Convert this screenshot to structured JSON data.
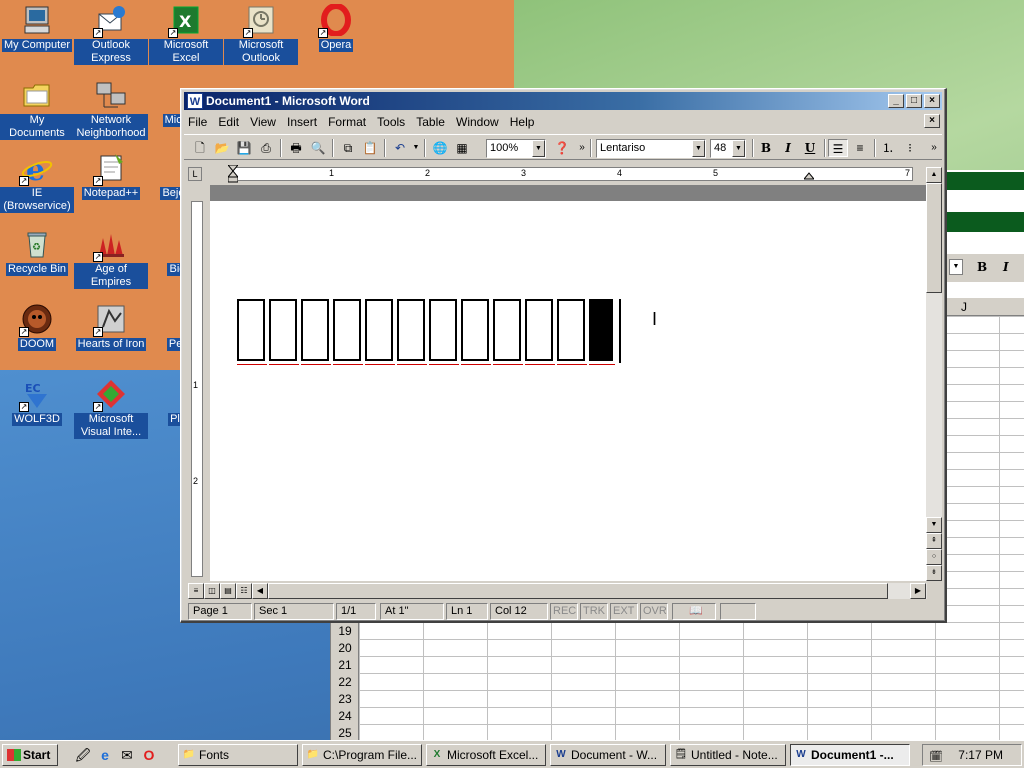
{
  "desktop": {
    "icons": [
      {
        "label": "My Computer",
        "icon": "computer-icon"
      },
      {
        "label": "Outlook Express",
        "icon": "outlook-express-icon"
      },
      {
        "label": "Microsoft Excel",
        "icon": "excel-icon"
      },
      {
        "label": "Microsoft Outlook",
        "icon": "outlook-icon"
      },
      {
        "label": "Opera",
        "icon": "opera-icon"
      },
      {
        "label": "My Documents",
        "icon": "folder-icon"
      },
      {
        "label": "Network Neighborhood",
        "icon": "network-icon"
      },
      {
        "label": "Mic Fron",
        "icon": "frontpage-icon"
      },
      {
        "label": "IE (Browservice)",
        "icon": "ie-icon"
      },
      {
        "label": "Notepad++",
        "icon": "notepad-icon"
      },
      {
        "label": "Bejew De",
        "icon": "bejeweled-icon"
      },
      {
        "label": "Recycle Bin",
        "icon": "recycle-bin-icon"
      },
      {
        "label": "Age of Empires",
        "icon": "age-of-empires-icon"
      },
      {
        "label": "Big De",
        "icon": "game-icon"
      },
      {
        "label": "DOOM",
        "icon": "doom-icon"
      },
      {
        "label": "Hearts of Iron",
        "icon": "hearts-of-iron-icon"
      },
      {
        "label": "Peggle",
        "icon": "peggle-icon"
      },
      {
        "label": "WOLF3D",
        "icon": "wolf3d-icon"
      },
      {
        "label": "Microsoft Visual Inte...",
        "icon": "visual-interdev-icon"
      },
      {
        "label": "Pla Zo",
        "icon": "game-icon"
      }
    ]
  },
  "excel": {
    "column_j": "J",
    "rows": [
      "19",
      "20",
      "21",
      "22",
      "23",
      "24",
      "25"
    ]
  },
  "word": {
    "title": "Document1 - Microsoft Word",
    "menu": [
      "File",
      "Edit",
      "View",
      "Insert",
      "Format",
      "Tools",
      "Table",
      "Window",
      "Help"
    ],
    "zoom": "100%",
    "font": "Lentariso",
    "font_size": "48",
    "toolbar_bold": "B",
    "toolbar_italic": "I",
    "toolbar_underline": "U",
    "ruler_numbers": [
      "1",
      "2",
      "3",
      "4",
      "5",
      "7"
    ],
    "vruler_numbers": [
      "1",
      "2"
    ],
    "status": {
      "page": "Page 1",
      "sec": "Sec 1",
      "pages": "1/1",
      "at": "At 1\"",
      "ln": "Ln 1",
      "col": "Col 12",
      "rec": "REC",
      "trk": "TRK",
      "ext": "EXT",
      "ovr": "OVR"
    }
  },
  "taskbar": {
    "start": "Start",
    "tasks": [
      {
        "label": "Fonts",
        "icon": "folder-icon"
      },
      {
        "label": "C:\\Program File...",
        "icon": "folder-icon"
      },
      {
        "label": "Microsoft Excel...",
        "icon": "excel-icon"
      },
      {
        "label": "Document - W...",
        "icon": "word-icon"
      },
      {
        "label": "Untitled - Note...",
        "icon": "notepad-icon"
      },
      {
        "label": "Document1 -...",
        "icon": "word-icon"
      }
    ],
    "clock": "7:17 PM"
  }
}
